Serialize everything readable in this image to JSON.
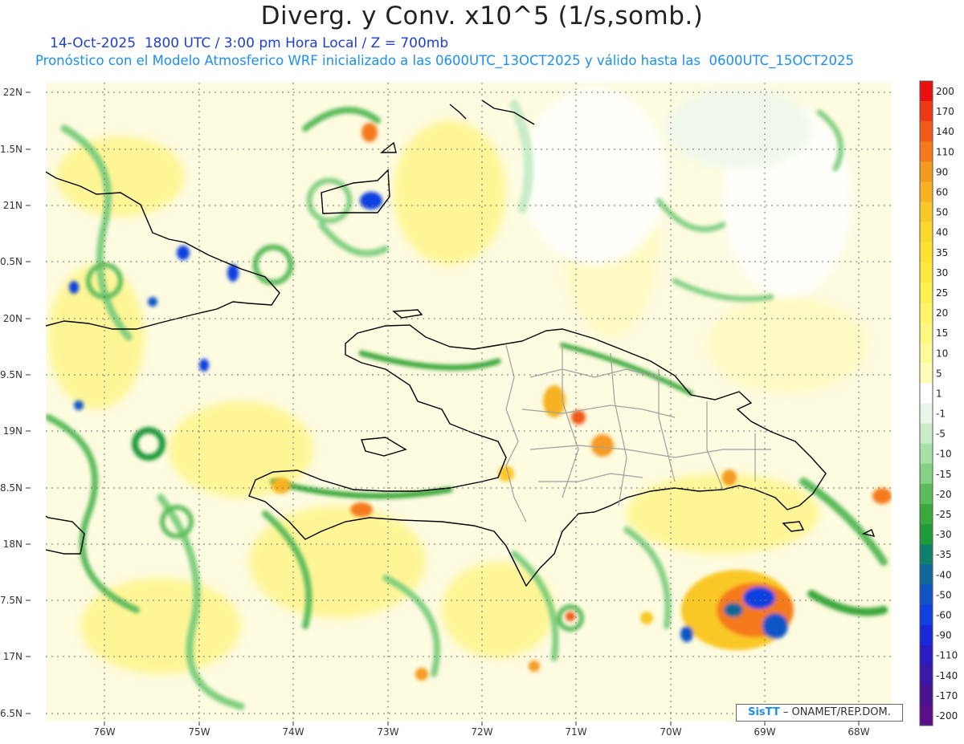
{
  "header": {
    "title": "Diverg. y Conv. x10^5 (1/s,somb.)",
    "line1": "14-Oct-2025  1800 UTC / 3:00 pm Hora Local / Z = 700mb",
    "line2": "Pronóstico con el Modelo Atmosferico WRF inicializado a las 0600UTC_13OCT2025 y válido hasta las  0600UTC_15OCT2025"
  },
  "axes": {
    "lat_labels": [
      "22N",
      "1.5N",
      "21N",
      "0.5N",
      "20N",
      "9.5N",
      "19N",
      "8.5N",
      "18N",
      "7.5N",
      "17N",
      "6.5N"
    ],
    "lon_labels": [
      "76W",
      "75W",
      "74W",
      "73W",
      "72W",
      "71W",
      "70W",
      "69W",
      "68W"
    ]
  },
  "colorbar": {
    "labels": [
      "200",
      "170",
      "140",
      "110",
      "90",
      "60",
      "50",
      "40",
      "35",
      "30",
      "25",
      "20",
      "15",
      "10",
      "5",
      "1",
      "-1",
      "-5",
      "-10",
      "-15",
      "-20",
      "-25",
      "-30",
      "-35",
      "-40",
      "-50",
      "-60",
      "-90",
      "-110",
      "-140",
      "-170",
      "-200"
    ],
    "colors": [
      "#e81010",
      "#ee3a14",
      "#f25a18",
      "#f47a1c",
      "#f59a20",
      "#f7b224",
      "#f9c828",
      "#fbd82c",
      "#fde232",
      "#fee83e",
      "#fff050",
      "#fff466",
      "#fff87e",
      "#fffa98",
      "#fffcb8",
      "#ffffff",
      "#eaf6ea",
      "#c8ecc8",
      "#a8e0a8",
      "#84d084",
      "#5cbc5c",
      "#3aa83a",
      "#1e9a3a",
      "#10806a",
      "#10689a",
      "#1054c4",
      "#1040e0",
      "#1828d8",
      "#2a1cc0",
      "#3a18a8",
      "#4a1490",
      "#5a1088"
    ]
  },
  "credit": {
    "brand": "SisTT",
    "org": "– ONAMET/REP.DOM."
  },
  "colors": {
    "title_text": "#222222",
    "line1_text": "#1f3fd0",
    "line2_text": "#1d8ff0",
    "coastline": "#000000",
    "provinces": "#a0a0a0"
  }
}
